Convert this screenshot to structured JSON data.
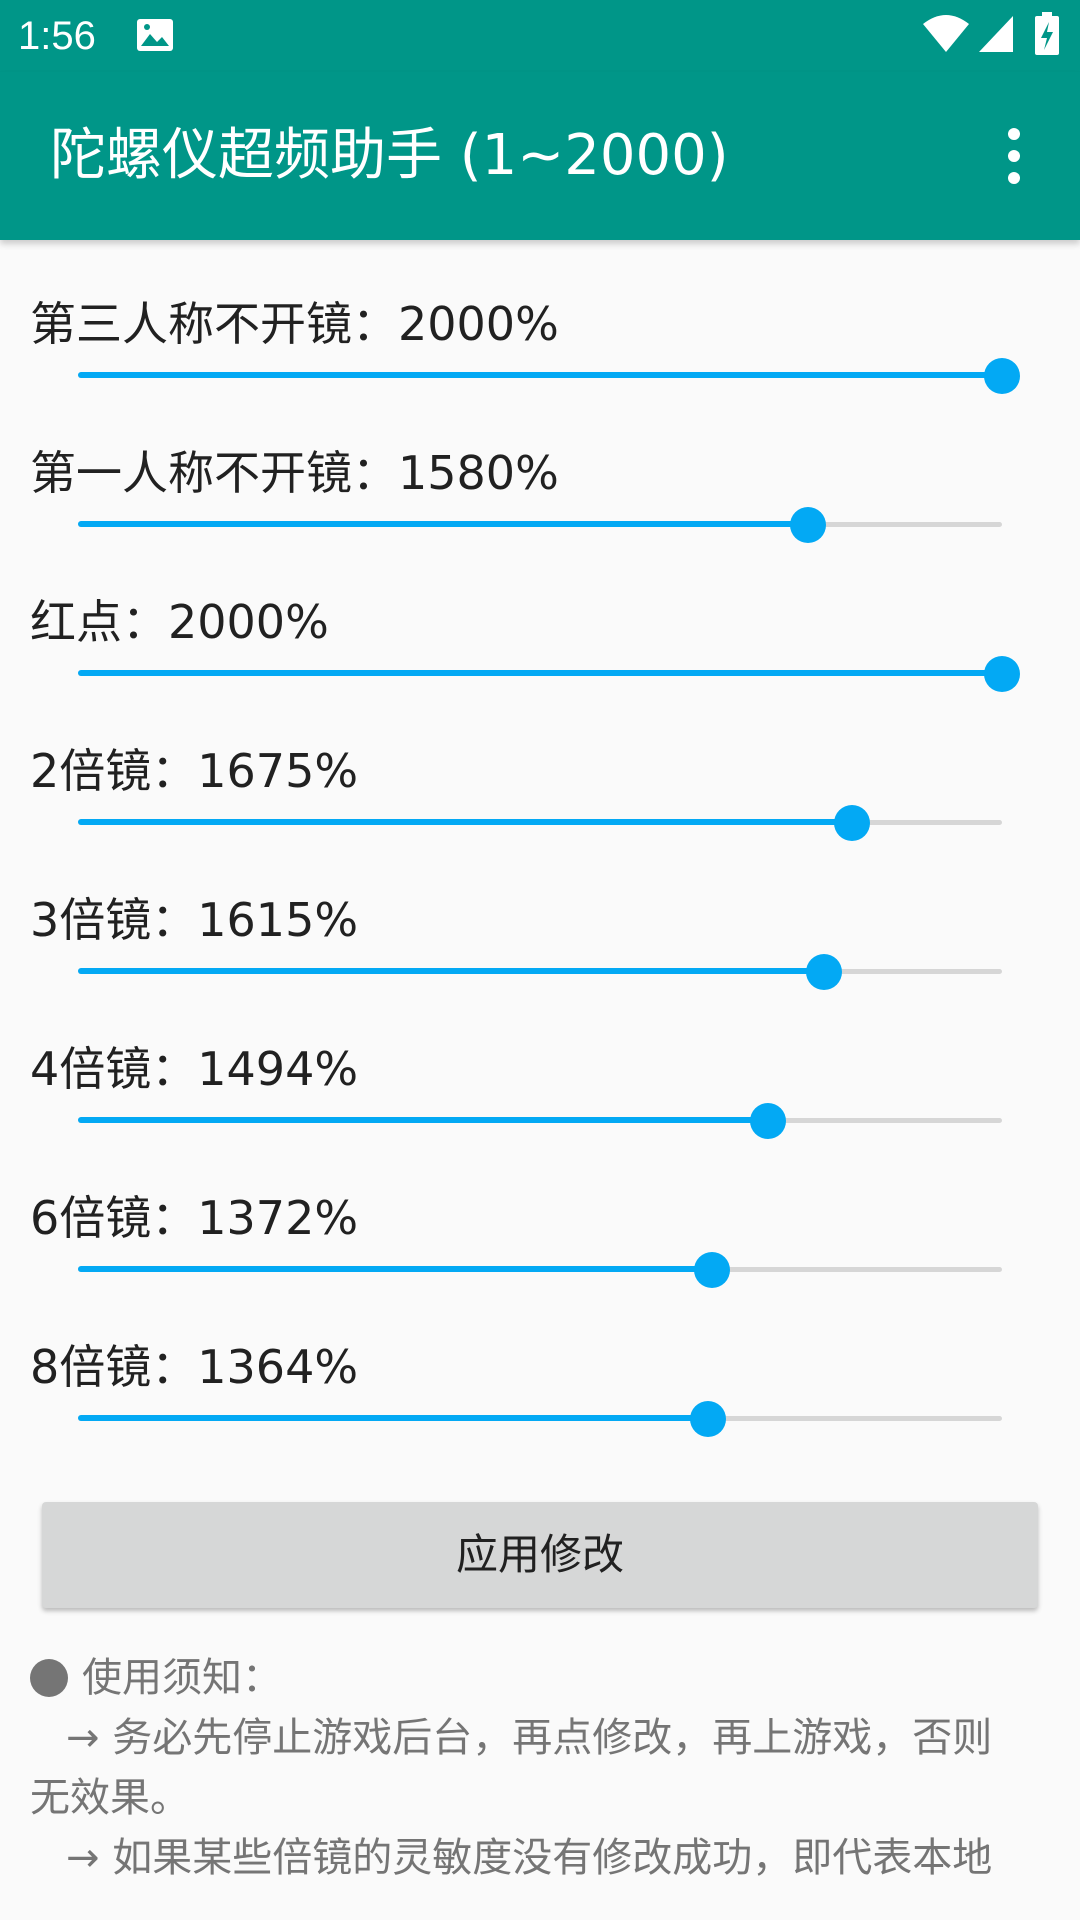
{
  "status_bar": {
    "time": "1:56",
    "icons": [
      "photo-icon",
      "wifi-icon",
      "signal-icon",
      "battery-charging-icon"
    ]
  },
  "app_bar": {
    "title": "陀螺仪超频助手 (1~2000)",
    "menu_icon": "more-vert-icon"
  },
  "slider_range": {
    "min": 1,
    "max": 2000
  },
  "settings": [
    {
      "label": "第三人称不开镜：2000%",
      "value": 2000
    },
    {
      "label": "第一人称不开镜：1580%",
      "value": 1580
    },
    {
      "label": "红点：2000%",
      "value": 2000
    },
    {
      "label": "2倍镜：1675%",
      "value": 1675
    },
    {
      "label": "3倍镜：1615%",
      "value": 1615
    },
    {
      "label": "4倍镜：1494%",
      "value": 1494
    },
    {
      "label": "6倍镜：1372%",
      "value": 1372
    },
    {
      "label": "8倍镜：1364%",
      "value": 1364
    }
  ],
  "apply_button": {
    "label": "应用修改"
  },
  "notes": {
    "heading": "使用须知：",
    "item1_line1": "→ 务必先停止游戏后台，再点修改，再上游戏，否则",
    "item1_line2": "无效果。",
    "item2_line1": "→ 如果某些倍镜的灵敏度没有修改成功，即代表本地"
  },
  "colors": {
    "primary": "#009688",
    "accent": "#03A9F4",
    "track": "#D6D6D6",
    "button": "#D6D7D7",
    "notes_text": "#757575"
  }
}
